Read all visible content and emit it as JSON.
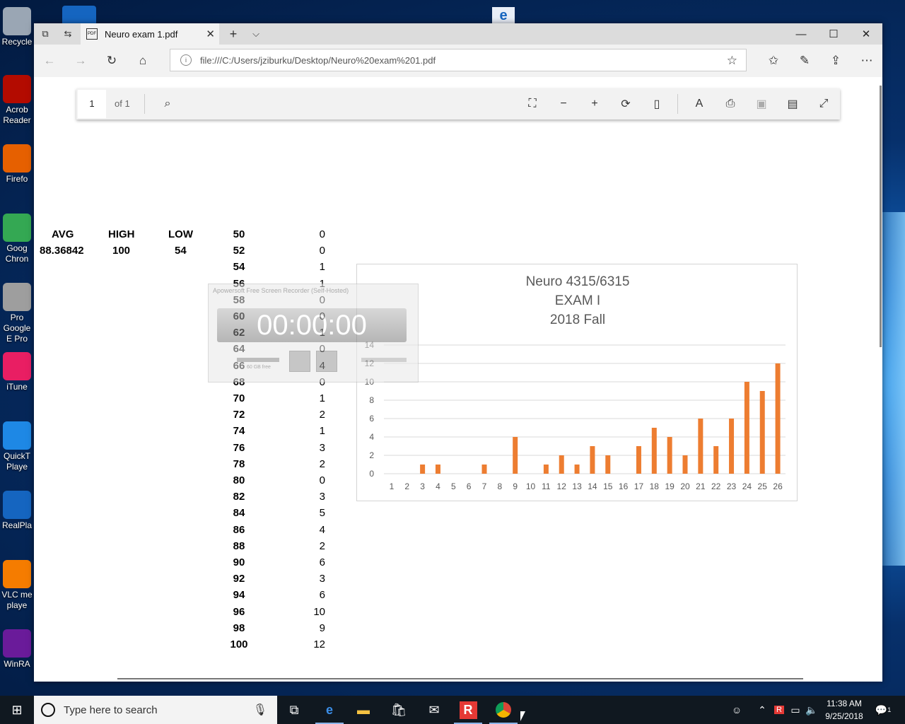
{
  "desktop": {
    "icons": [
      {
        "label": "Recycle",
        "color": "#9aa6b4"
      },
      {
        "label": "Acrob Reader",
        "color": "#b30b00"
      },
      {
        "label": "Firefo",
        "color": "#e66000"
      },
      {
        "label": "Goog Chron",
        "color": "#34a853"
      },
      {
        "label": "Pro Google E Pro",
        "color": "#9e9e9e"
      },
      {
        "label": "iTune",
        "color": "#e91e63"
      },
      {
        "label": "QuickT Playe",
        "color": "#1e88e5"
      },
      {
        "label": "RealPla",
        "color": "#1565c0"
      },
      {
        "label": "VLC me playe",
        "color": "#f57c00"
      },
      {
        "label": "WinRA",
        "color": "#6a1b9a"
      }
    ]
  },
  "browser": {
    "tab_title": "Neuro exam 1.pdf",
    "tab_close": "✕",
    "new_tab": "+",
    "tab_list": "⌵",
    "url": "file:///C:/Users/jziburku/Desktop/Neuro%20exam%201.pdf",
    "minimize": "—",
    "maximize": "☐",
    "close": "✕"
  },
  "pdf_toolbar": {
    "page_number": "1",
    "page_of": "of 1"
  },
  "stats": {
    "avg_label": "AVG",
    "high_label": "HIGH",
    "low_label": "LOW",
    "avg_value": "88.36842",
    "high_value": "100",
    "low_value": "54"
  },
  "distribution": [
    {
      "score": "50",
      "count": "0"
    },
    {
      "score": "52",
      "count": "0"
    },
    {
      "score": "54",
      "count": "1"
    },
    {
      "score": "56",
      "count": "1"
    },
    {
      "score": "58",
      "count": "0"
    },
    {
      "score": "60",
      "count": "0"
    },
    {
      "score": "62",
      "count": "1"
    },
    {
      "score": "64",
      "count": "0"
    },
    {
      "score": "66",
      "count": "4"
    },
    {
      "score": "68",
      "count": "0"
    },
    {
      "score": "70",
      "count": "1"
    },
    {
      "score": "72",
      "count": "2"
    },
    {
      "score": "74",
      "count": "1"
    },
    {
      "score": "76",
      "count": "3"
    },
    {
      "score": "78",
      "count": "2"
    },
    {
      "score": "80",
      "count": "0"
    },
    {
      "score": "82",
      "count": "3"
    },
    {
      "score": "84",
      "count": "5"
    },
    {
      "score": "86",
      "count": "4"
    },
    {
      "score": "88",
      "count": "2"
    },
    {
      "score": "90",
      "count": "6"
    },
    {
      "score": "92",
      "count": "3"
    },
    {
      "score": "94",
      "count": "6"
    },
    {
      "score": "96",
      "count": "10"
    },
    {
      "score": "98",
      "count": "9"
    },
    {
      "score": "100",
      "count": "12"
    }
  ],
  "chart_data": {
    "type": "bar",
    "title_lines": [
      "Neuro 4315/6315",
      "EXAM I",
      "2018 Fall"
    ],
    "categories": [
      "1",
      "2",
      "3",
      "4",
      "5",
      "6",
      "7",
      "8",
      "9",
      "10",
      "11",
      "12",
      "13",
      "14",
      "15",
      "16",
      "17",
      "18",
      "19",
      "20",
      "21",
      "22",
      "23",
      "24",
      "25",
      "26"
    ],
    "values": [
      0,
      0,
      1,
      1,
      0,
      0,
      1,
      0,
      4,
      0,
      1,
      2,
      1,
      3,
      2,
      0,
      3,
      5,
      4,
      2,
      6,
      3,
      6,
      10,
      9,
      12
    ],
    "ylim": [
      0,
      14
    ],
    "yticks": [
      0,
      2,
      4,
      6,
      8,
      10,
      12,
      14
    ],
    "color": "#ed7d31",
    "grid": true
  },
  "recorder": {
    "title": "Apowersoft Free Screen Recorder (Self-Hosted)",
    "timer": "00:00:00",
    "disk_free": "60 GB free"
  },
  "taskbar": {
    "search_placeholder": "Type here to search",
    "time": "11:38 AM",
    "date": "9/25/2018",
    "notification_count": "1"
  }
}
